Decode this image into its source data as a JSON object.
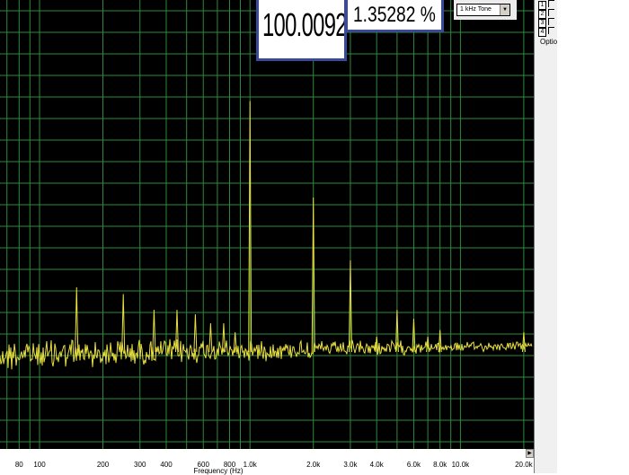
{
  "readouts": {
    "level": "100.0092 %",
    "thd": "1.35282 %"
  },
  "generator": {
    "selected": "1 kHz Tone",
    "arrow": "▼"
  },
  "side_panel": {
    "channels": [
      "1",
      "2",
      "3",
      "4"
    ],
    "options_label": "Optio"
  },
  "scroll": {
    "right_arrow": "▶"
  },
  "colors": {
    "background": "#000000",
    "grid": "#2e8a3a",
    "trace": "#e8e040",
    "readout_border": "#3a4a9a"
  },
  "chart_data": {
    "type": "line",
    "title": "",
    "xlabel": "Frequency (Hz)",
    "ylabel": "",
    "x_scale": "log",
    "xlim": [
      50,
      22000
    ],
    "y_scale": "relative",
    "grid": true,
    "x_tick_labels": [
      {
        "value": 80,
        "label": "80"
      },
      {
        "value": 100,
        "label": "100"
      },
      {
        "value": 200,
        "label": "200"
      },
      {
        "value": 300,
        "label": "300"
      },
      {
        "value": 400,
        "label": "400"
      },
      {
        "value": 600,
        "label": "600"
      },
      {
        "value": 800,
        "label": "800"
      },
      {
        "value": 1000,
        "label": "1.0k"
      },
      {
        "value": 2000,
        "label": "2.0k"
      },
      {
        "value": 3000,
        "label": "3.0k"
      },
      {
        "value": 4000,
        "label": "4.0k"
      },
      {
        "value": 6000,
        "label": "6.0k"
      },
      {
        "value": 8000,
        "label": "8.0k"
      },
      {
        "value": 10000,
        "label": "10.0k"
      },
      {
        "value": 20000,
        "label": "20.0k"
      }
    ],
    "grid_lines_x": [
      60,
      70,
      80,
      90,
      100,
      200,
      300,
      400,
      500,
      600,
      700,
      800,
      900,
      1000,
      2000,
      3000,
      4000,
      5000,
      6000,
      7000,
      8000,
      9000,
      10000,
      20000
    ],
    "grid_lines_y_fraction": [
      0.024,
      0.072,
      0.12,
      0.168,
      0.216,
      0.264,
      0.312,
      0.36,
      0.408,
      0.456,
      0.504,
      0.552,
      0.6,
      0.648,
      0.696,
      0.744,
      0.792,
      0.84,
      0.888,
      0.936,
      0.984
    ],
    "noise_floor_fraction": 0.79,
    "peaks": [
      {
        "freq": 150,
        "level": 0.64
      },
      {
        "freq": 250,
        "level": 0.655
      },
      {
        "freq": 350,
        "level": 0.69
      },
      {
        "freq": 450,
        "level": 0.69
      },
      {
        "freq": 550,
        "level": 0.7
      },
      {
        "freq": 650,
        "level": 0.72
      },
      {
        "freq": 750,
        "level": 0.72
      },
      {
        "freq": 850,
        "level": 0.74
      },
      {
        "freq": 1000,
        "level": 0.225
      },
      {
        "freq": 2000,
        "level": 0.44
      },
      {
        "freq": 3000,
        "level": 0.58
      },
      {
        "freq": 4000,
        "level": 0.75
      },
      {
        "freq": 5000,
        "level": 0.69
      },
      {
        "freq": 6000,
        "level": 0.71
      },
      {
        "freq": 7000,
        "level": 0.75
      },
      {
        "freq": 8000,
        "level": 0.735
      },
      {
        "freq": 20000,
        "level": 0.74
      }
    ]
  }
}
